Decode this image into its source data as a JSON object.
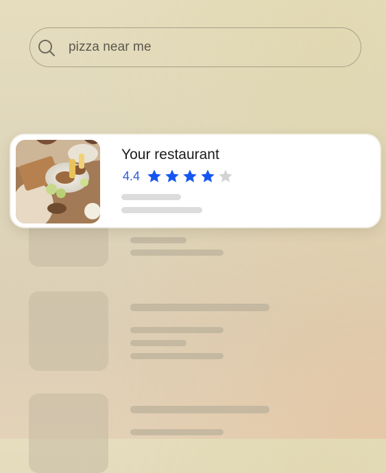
{
  "search": {
    "query": "pizza near me",
    "icon": "search-icon"
  },
  "featured_result": {
    "name": "Your restaurant",
    "rating_text": "4.4",
    "rating": 4.4,
    "max_stars": 5,
    "filled_stars": 4,
    "star_color": "#1556f2",
    "empty_star_color": "#d4d4d4",
    "image": "restaurant-photo"
  },
  "placeholder_results_count": 3,
  "colors": {
    "rating_text": "#2a5bd7",
    "card_background": "#ffffff"
  }
}
